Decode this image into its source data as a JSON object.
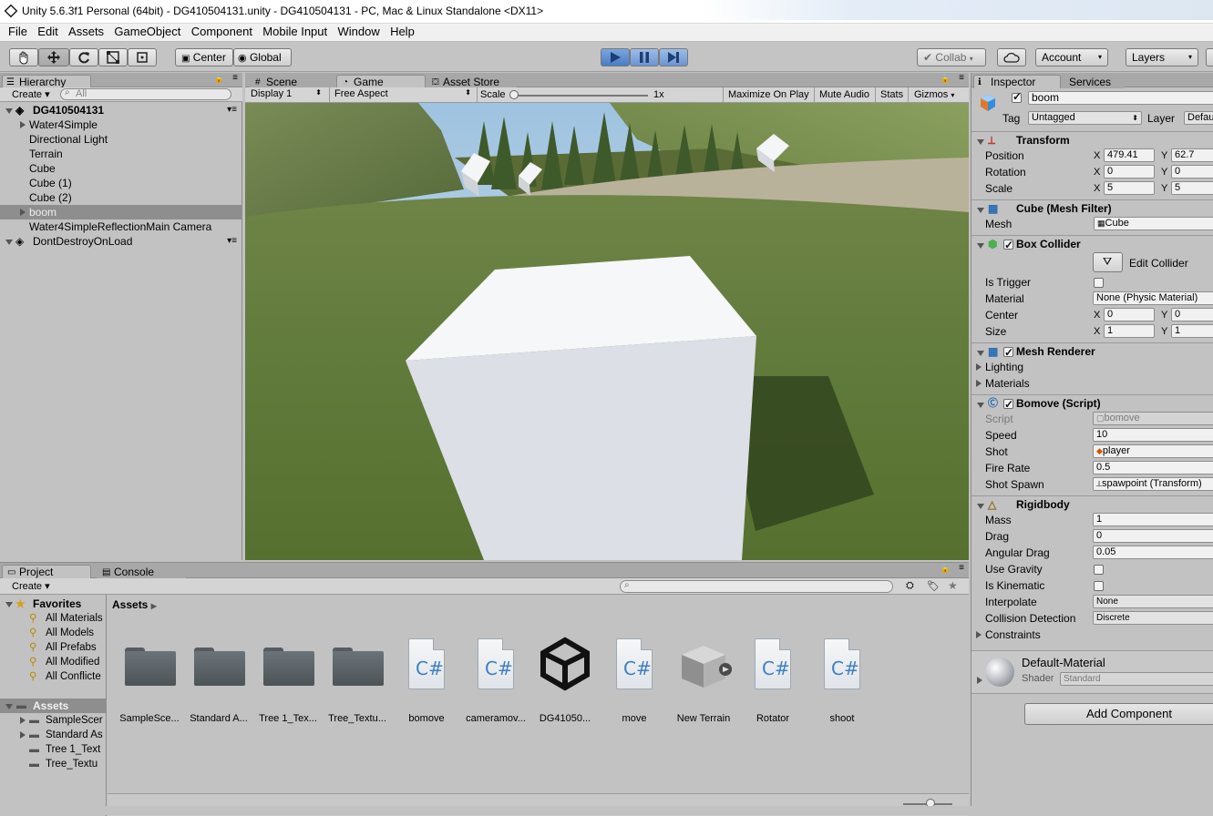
{
  "window": {
    "title": "Unity 5.6.3f1 Personal (64bit) - DG410504131.unity - DG410504131 - PC, Mac & Linux Standalone <DX11>"
  },
  "menu": [
    "File",
    "Edit",
    "Assets",
    "GameObject",
    "Component",
    "Mobile Input",
    "Window",
    "Help"
  ],
  "toolbar": {
    "pivot": "Center",
    "space": "Global",
    "collab": "Collab",
    "account": "Account",
    "layers": "Layers"
  },
  "hierarchy": {
    "tab": "Hierarchy",
    "create": "Create",
    "search_placeholder": "All",
    "scene": "DG410504131",
    "items": [
      "Water4Simple",
      "Directional Light",
      "Terrain",
      "Cube",
      "Cube (1)",
      "Cube (2)",
      "boom",
      "Water4SimpleReflectionMain Camera"
    ],
    "dontdestroy": "DontDestroyOnLoad"
  },
  "center_tabs": {
    "scene": "Scene",
    "game": "Game",
    "asset_store": "Asset Store"
  },
  "game_bar": {
    "display": "Display 1",
    "aspect": "Free Aspect",
    "scale_label": "Scale",
    "scale_value": "1x",
    "maximize": "Maximize On Play",
    "mute": "Mute Audio",
    "stats": "Stats",
    "gizmos": "Gizmos"
  },
  "inspector": {
    "tab": "Inspector",
    "tab2": "Services",
    "object_name": "boom",
    "tag_label": "Tag",
    "tag_value": "Untagged",
    "layer_label": "Layer",
    "layer_value": "Defau",
    "transform": {
      "title": "Transform",
      "position_label": "Position",
      "position_x": "479.41",
      "position_y": "62.7",
      "rotation_label": "Rotation",
      "rotation_x": "0",
      "rotation_y": "0",
      "scale_label": "Scale",
      "scale_x": "5",
      "scale_y": "5"
    },
    "mesh_filter": {
      "title": "Cube (Mesh Filter)",
      "mesh_label": "Mesh",
      "mesh_value": "Cube"
    },
    "box_collider": {
      "title": "Box Collider",
      "edit_collider": "Edit Collider",
      "is_trigger": "Is Trigger",
      "material_label": "Material",
      "material_value": "None (Physic Material)",
      "center_label": "Center",
      "center_x": "0",
      "center_y": "0",
      "size_label": "Size",
      "size_x": "1",
      "size_y": "1"
    },
    "mesh_renderer": {
      "title": "Mesh Renderer",
      "lighting": "Lighting",
      "materials": "Materials"
    },
    "bomove": {
      "title": "Bomove (Script)",
      "script_label": "Script",
      "script_value": "bomove",
      "speed_label": "Speed",
      "speed_value": "10",
      "shot_label": "Shot",
      "shot_value": "player",
      "fire_rate_label": "Fire Rate",
      "fire_rate_value": "0.5",
      "shot_spawn_label": "Shot Spawn",
      "shot_spawn_value": "spawpoint (Transform)"
    },
    "rigidbody": {
      "title": "Rigidbody",
      "mass_label": "Mass",
      "mass_value": "1",
      "drag_label": "Drag",
      "drag_value": "0",
      "angular_drag_label": "Angular Drag",
      "angular_drag_value": "0.05",
      "use_gravity": "Use Gravity",
      "is_kinematic": "Is Kinematic",
      "interpolate_label": "Interpolate",
      "interpolate_value": "None",
      "collision_label": "Collision Detection",
      "collision_value": "Discrete",
      "constraints": "Constraints"
    },
    "material": {
      "name": "Default-Material",
      "shader_label": "Shader",
      "shader_value": "Standard"
    },
    "add_component": "Add Component"
  },
  "project": {
    "tab": "Project",
    "tab2": "Console",
    "create": "Create",
    "favorites_title": "Favorites",
    "favorites": [
      "All Materials",
      "All Models",
      "All Prefabs",
      "All Modified",
      "All Conflicte"
    ],
    "assets_title": "Assets",
    "asset_folders": [
      "SampleScer",
      "Standard As",
      "Tree 1_Text",
      "Tree_Textu"
    ],
    "breadcrumb": "Assets",
    "grid_items": [
      {
        "label": "SampleSce...",
        "kind": "folder"
      },
      {
        "label": "Standard A...",
        "kind": "folder"
      },
      {
        "label": "Tree 1_Tex...",
        "kind": "folder"
      },
      {
        "label": "Tree_Textu...",
        "kind": "folder"
      },
      {
        "label": "bomove",
        "kind": "script"
      },
      {
        "label": "cameramov...",
        "kind": "script"
      },
      {
        "label": "DG41050...",
        "kind": "scene"
      },
      {
        "label": "move",
        "kind": "script"
      },
      {
        "label": "New Terrain",
        "kind": "terrain"
      },
      {
        "label": "Rotator",
        "kind": "script"
      },
      {
        "label": "shoot",
        "kind": "script"
      }
    ]
  }
}
